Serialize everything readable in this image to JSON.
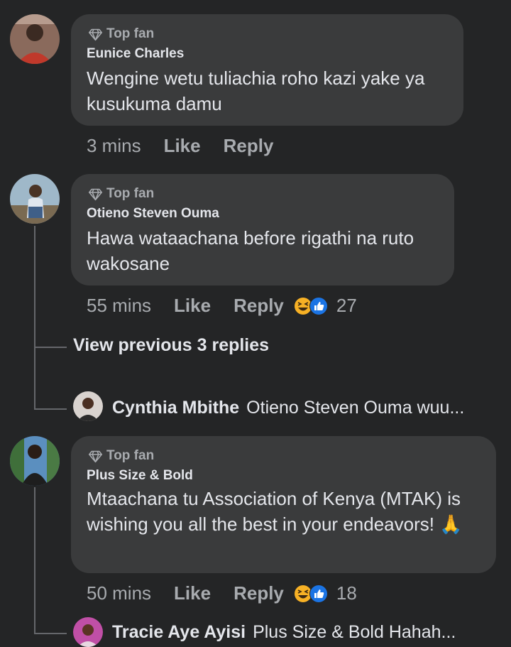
{
  "comments": [
    {
      "badge": "Top fan",
      "author": "Eunice Charles",
      "text": "Wengine wetu tuliachia roho kazi yake ya kusukuma damu",
      "time": "3 mins",
      "like": "Like",
      "reply": "Reply"
    },
    {
      "badge": "Top fan",
      "author": "Otieno Steven Ouma",
      "text": "Hawa wataachana before rigathi na ruto wakosane",
      "time": "55 mins",
      "like": "Like",
      "reply": "Reply",
      "reaction_count": "27"
    },
    {
      "badge": "Top fan",
      "author": "Plus Size & Bold",
      "text": "Mtaachana tu Association of Kenya (MTAK) is wishing you all the best in your endeavors! 🙏",
      "time": "50 mins",
      "like": "Like",
      "reply": "Reply",
      "reaction_count": "18"
    }
  ],
  "view_previous": "View previous 3 replies",
  "replies": [
    {
      "author": "Cynthia Mbithe",
      "text": "Otieno Steven Ouma wuu..."
    },
    {
      "author": "Tracie Aye Ayisi",
      "text": "Plus Size & Bold Hahah..."
    }
  ],
  "colors": {
    "background": "#242526",
    "bubble": "#3a3b3c",
    "secondary_text": "#a8abaf",
    "like_blue": "#1b74e4",
    "haha_yellow": "#f7b125"
  },
  "icons": [
    "diamond-icon",
    "haha-reaction-icon",
    "like-reaction-icon"
  ]
}
